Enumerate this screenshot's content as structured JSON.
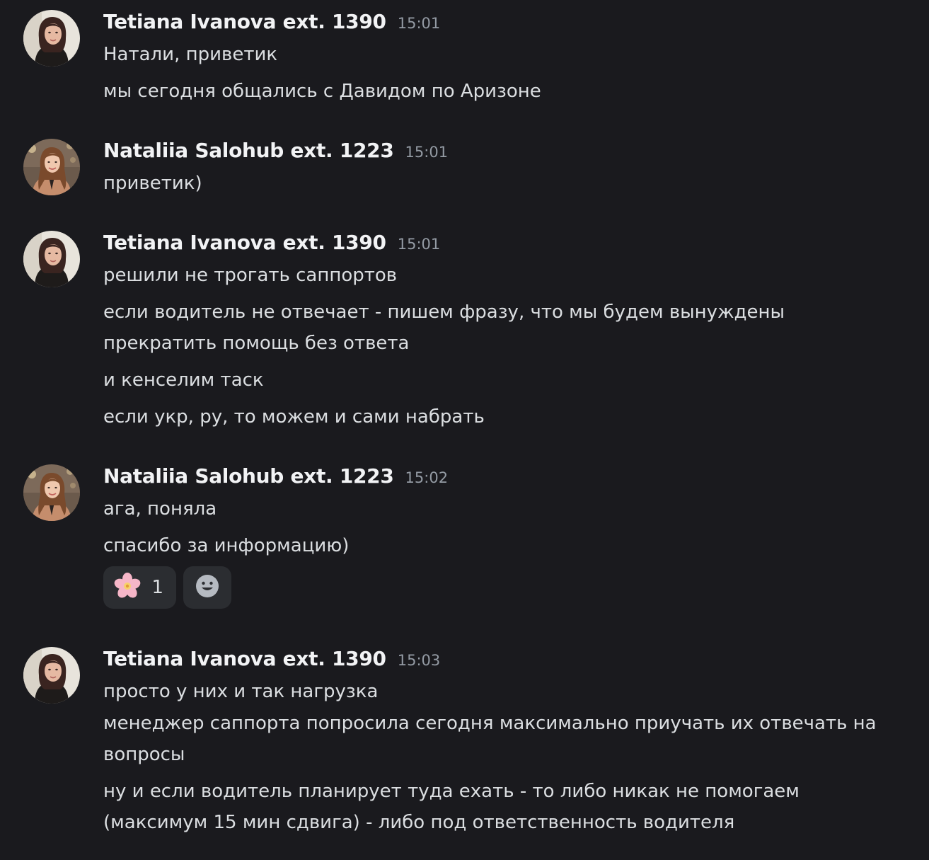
{
  "messages": [
    {
      "author": "Tetiana Ivanova ext. 1390",
      "time": "15:01",
      "avatar": "avatar-tetiana",
      "lines": [
        "Натали, приветик",
        "мы сегодня общались с Давидом по Аризоне"
      ]
    },
    {
      "author": "Nataliia Salohub ext. 1223",
      "time": "15:01",
      "avatar": "avatar-nataliia",
      "lines": [
        "приветик)"
      ]
    },
    {
      "author": "Tetiana Ivanova ext. 1390",
      "time": "15:01",
      "avatar": "avatar-tetiana",
      "lines": [
        "решили не трогать саппортов",
        "если водитель не отвечает - пишем фразу, что мы будем вынуждены прекратить помощь без ответа",
        "и кенселим таск",
        "если укр, ру, то можем и сами набрать"
      ]
    },
    {
      "author": "Nataliia Salohub ext. 1223",
      "time": "15:02",
      "avatar": "avatar-nataliia",
      "lines": [
        "ага, поняла",
        "спасибо за информацию)"
      ],
      "reactions": [
        {
          "emoji": "cherry-blossom-icon",
          "count": "1"
        },
        {
          "emoji": "add-reaction-icon"
        }
      ]
    },
    {
      "author": "Tetiana Ivanova ext. 1390",
      "time": "15:03",
      "avatar": "avatar-tetiana",
      "lines": [
        "просто у них и так нагрузка",
        "менеджер саппорта попросила сегодня максимально приучать их отвечать на вопросы",
        "ну и если водитель планирует туда ехать - то либо никак не помогаем (максимум 15 мин сдвига) - либо под ответственность водителя"
      ]
    }
  ],
  "colors": {
    "background": "#1a1a1e",
    "author": "#f2f3f5",
    "timestamp": "#949ba4",
    "text": "#dbdee1",
    "reaction_bg": "#2b2d31"
  }
}
